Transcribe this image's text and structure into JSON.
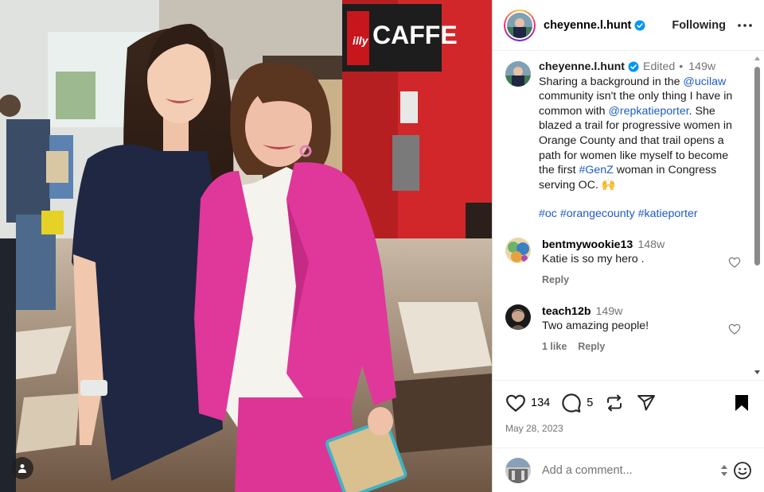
{
  "photo": {
    "sign_text": "CAFFE",
    "logo_text": "illy"
  },
  "header": {
    "username": "cheyenne.l.hunt",
    "follow_label": "Following"
  },
  "caption": {
    "username": "cheyenne.l.hunt",
    "edited_label": "Edited",
    "separator": "•",
    "time": "149w",
    "parts": [
      "Sharing a background in the ",
      "@ucilaw",
      " community isn't the only thing I have in common with ",
      "@repkatieporter",
      ". She blazed a trail for progressive women in Orange County and that trail opens a path for women like myself to become the first ",
      "#GenZ",
      " woman in Congress serving OC. 🙌"
    ],
    "hashtags": [
      "#oc",
      "#orangecounty",
      "#katieporter"
    ]
  },
  "comments": [
    {
      "username": "bentmywookie13",
      "time": "148w",
      "text": "Katie is so my hero .",
      "likes": "",
      "reply_label": "Reply"
    },
    {
      "username": "teach12b",
      "time": "149w",
      "text": "Two amazing people!",
      "likes": "1 like",
      "reply_label": "Reply"
    }
  ],
  "actions": {
    "like_count": "134",
    "comment_count": "5",
    "date": "May 28, 2023"
  },
  "add_comment": {
    "placeholder": "Add a comment..."
  },
  "icons": [
    "verified-badge-icon",
    "more-options-icon",
    "heart-icon",
    "comment-icon",
    "repost-icon",
    "share-icon",
    "bookmark-icon",
    "emoji-icon",
    "user-tag-icon"
  ],
  "colors": {
    "link": "#1f5bc7",
    "muted": "#737373",
    "verified": "#0095f6",
    "blazer": "#e0379a"
  }
}
